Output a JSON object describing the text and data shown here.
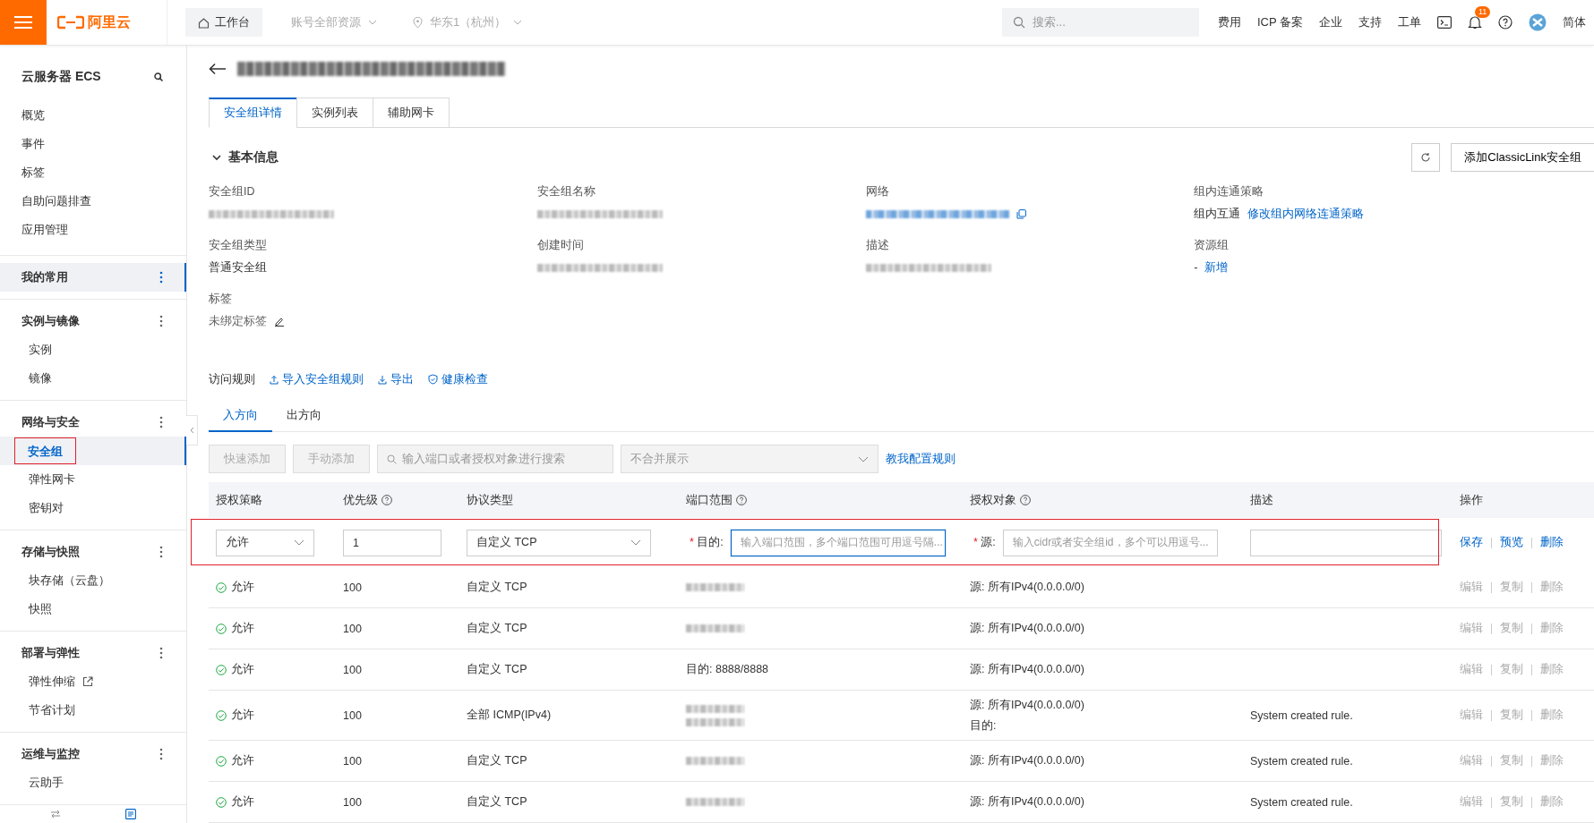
{
  "topbar": {
    "logo": "阿里云",
    "workbench": "工作台",
    "account": "账号全部资源",
    "region": "华东1（杭州）",
    "search_placeholder": "搜索...",
    "links": [
      "费用",
      "ICP 备案",
      "企业",
      "支持",
      "工单"
    ],
    "notification_count": "11",
    "language": "简体"
  },
  "sidebar": {
    "title": "云服务器 ECS",
    "items": [
      "概览",
      "事件",
      "标签",
      "自助问题排查",
      "应用管理"
    ],
    "groups": [
      {
        "title": "我的常用",
        "highlighted": true
      },
      {
        "title": "实例与镜像",
        "highlighted": false,
        "items": [
          {
            "label": "实例",
            "selected": false,
            "external": false
          },
          {
            "label": "镜像",
            "selected": false,
            "external": false
          }
        ]
      },
      {
        "title": "网络与安全",
        "highlighted": false,
        "items": [
          {
            "label": "安全组",
            "selected": true,
            "external": false
          },
          {
            "label": "弹性网卡",
            "selected": false,
            "external": false
          },
          {
            "label": "密钥对",
            "selected": false,
            "external": false
          }
        ]
      },
      {
        "title": "存储与快照",
        "highlighted": false,
        "items": [
          {
            "label": "块存储（云盘）",
            "selected": false,
            "external": false
          },
          {
            "label": "快照",
            "selected": false,
            "external": false
          }
        ]
      },
      {
        "title": "部署与弹性",
        "highlighted": false,
        "items": [
          {
            "label": "弹性伸缩",
            "selected": false,
            "external": true
          },
          {
            "label": "节省计划",
            "selected": false,
            "external": false
          }
        ]
      },
      {
        "title": "运维与监控",
        "highlighted": false,
        "items": [
          {
            "label": "云助手",
            "selected": false,
            "external": false
          }
        ]
      }
    ]
  },
  "tabs": [
    {
      "label": "安全组详情",
      "selected": true
    },
    {
      "label": "实例列表",
      "selected": false
    },
    {
      "label": "辅助网卡",
      "selected": false
    }
  ],
  "basic_info": {
    "title": "基本信息",
    "expanded": true,
    "button": "添加ClassicLink安全组",
    "fields": [
      {
        "label": "安全组ID",
        "kind": "blurred"
      },
      {
        "label": "安全组名称",
        "kind": "blurred"
      },
      {
        "label": "网络",
        "kind": "blurred_link"
      },
      {
        "label": "组内连通策略",
        "kind": "text",
        "value": "组内互通",
        "link": "修改组内网络连通策略"
      },
      {
        "label": "安全组类型",
        "kind": "text",
        "value": "普通安全组"
      },
      {
        "label": "创建时间",
        "kind": "blurred"
      },
      {
        "label": "描述",
        "kind": "blurred"
      },
      {
        "label": "资源组",
        "kind": "text",
        "value": "-",
        "link": "新增"
      },
      {
        "label": "标签",
        "kind": "editable",
        "value": "未绑定标签"
      }
    ]
  },
  "rules": {
    "title": "访问规则",
    "actions": [
      "导入安全组规则",
      "导出",
      "健康检查"
    ],
    "directions": [
      {
        "label": "入方向",
        "selected": true
      },
      {
        "label": "出方向",
        "selected": false
      }
    ],
    "toolbar": {
      "buttons": [
        {
          "label": "快速添加",
          "disabled": true
        },
        {
          "label": "手动添加",
          "disabled": true
        }
      ],
      "search_placeholder": "输入端口或者授权对象进行搜索",
      "merge_select": "不合并展示",
      "help_link": "教我配置规则"
    },
    "columns": [
      {
        "label": "授权策略",
        "help": false
      },
      {
        "label": "优先级",
        "help": true
      },
      {
        "label": "协议类型",
        "help": false
      },
      {
        "label": "端口范围",
        "help": true
      },
      {
        "label": "授权对象",
        "help": true
      },
      {
        "label": "描述",
        "help": false
      },
      {
        "label": "操作",
        "help": false
      }
    ],
    "edit_row": {
      "policy": "允许",
      "priority": "1",
      "protocol": "自定义 TCP",
      "port_mark": "*",
      "port_label": "目的:",
      "port_placeholder": "输入端口范围，多个端口范围可用逗号隔...",
      "source_mark": "*",
      "source_label": "源:",
      "source_placeholder": "输入cidr或者安全组id，多个可以用逗号...",
      "actions": [
        "保存",
        "预览",
        "删除"
      ]
    },
    "rows": [
      {
        "policy": "允许",
        "priority": "100",
        "protocol": "自定义 TCP",
        "port": [
          {
            "kind": "blurred"
          }
        ],
        "object": [
          "源: 所有IPv4(0.0.0.0/0)"
        ],
        "actions": [
          "编辑",
          "复制",
          "删除"
        ]
      },
      {
        "policy": "允许",
        "priority": "100",
        "protocol": "自定义 TCP",
        "port": [
          {
            "kind": "blurred"
          }
        ],
        "object": [
          "源: 所有IPv4(0.0.0.0/0)"
        ],
        "actions": [
          "编辑",
          "复制",
          "删除"
        ]
      },
      {
        "policy": "允许",
        "priority": "100",
        "protocol": "自定义 TCP",
        "port": [
          {
            "kind": "text",
            "text": "目的: 8888/8888"
          }
        ],
        "object": [
          "源: 所有IPv4(0.0.0.0/0)"
        ],
        "actions": [
          "编辑",
          "复制",
          "删除"
        ]
      },
      {
        "policy": "允许",
        "priority": "100",
        "protocol": "全部 ICMP(IPv4)",
        "port": [
          {
            "kind": "blurred"
          },
          {
            "kind": "blurred"
          }
        ],
        "object": [
          "源: 所有IPv4(0.0.0.0/0)",
          "目的:"
        ],
        "description": "System created rule.",
        "actions": [
          "编辑",
          "复制",
          "删除"
        ]
      },
      {
        "policy": "允许",
        "priority": "100",
        "protocol": "自定义 TCP",
        "port": [
          {
            "kind": "blurred"
          }
        ],
        "object": [
          "源: 所有IPv4(0.0.0.0/0)"
        ],
        "description": "System created rule.",
        "actions": [
          "编辑",
          "复制",
          "删除"
        ]
      },
      {
        "policy": "允许",
        "priority": "100",
        "protocol": "自定义 TCP",
        "port": [
          {
            "kind": "blurred"
          }
        ],
        "object": [
          "源: 所有IPv4(0.0.0.0/0)"
        ],
        "description": "System created rule.",
        "actions": [
          "编辑",
          "复制",
          "删除"
        ]
      }
    ]
  }
}
